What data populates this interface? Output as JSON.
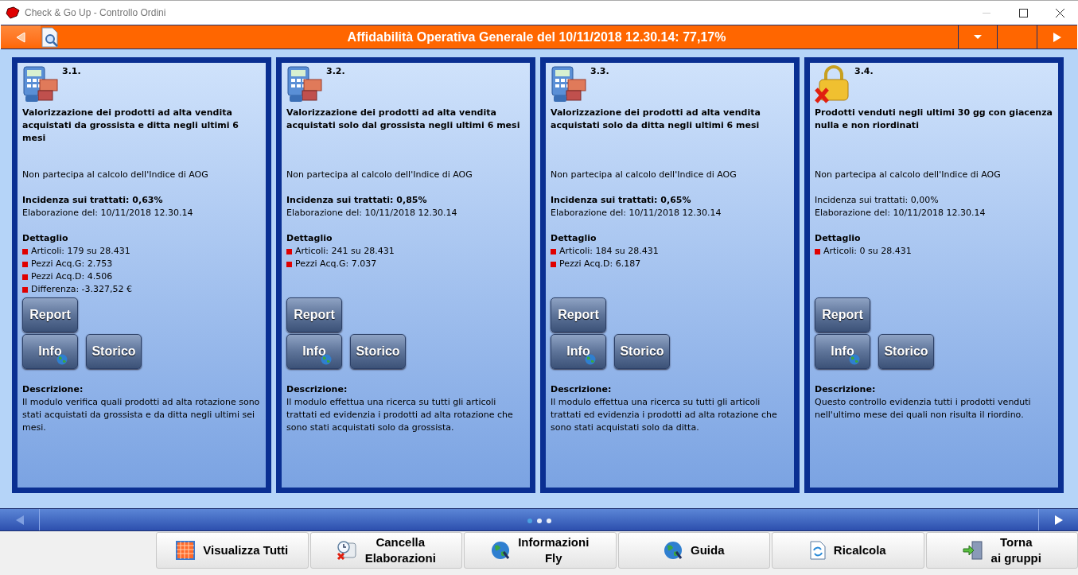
{
  "window": {
    "title": "Check & Go Up - Controllo Ordini"
  },
  "header": {
    "title": "Affidabilità Operativa Generale del 10/11/2018 12.30.14: 77,17%"
  },
  "cards": [
    {
      "kind": "calculator",
      "number": "3.1.",
      "title": "Valorizzazione dei prodotti ad alta vendita acquistati da grossista e ditta negli ultimi 6 mesi",
      "note": "Non partecipa al calcolo dell'Indice di AOG",
      "incidence": {
        "text": "Incidenza sui trattati: 0,63%",
        "emphasized": true
      },
      "elaboration": "Elaborazione del: 10/11/2018 12.30.14",
      "detail_heading": "Dettaglio",
      "details": [
        "Articoli: 179 su 28.431",
        "Pezzi Acq.G: 2.753",
        "Pezzi Acq.D: 4.506",
        "Differenza: -3.327,52 €"
      ],
      "buttons": {
        "report": "Report",
        "info": "Info",
        "history": "Storico"
      },
      "description_heading": "Descrizione:",
      "description": "Il modulo verifica quali prodotti ad alta rotazione sono stati acquistati da grossista e da ditta negli ultimi sei mesi."
    },
    {
      "kind": "calculator",
      "number": "3.2.",
      "title": "Valorizzazione dei prodotti ad alta vendita acquistati solo dal grossista negli ultimi 6 mesi",
      "note": "Non partecipa al calcolo dell'Indice di AOG",
      "incidence": {
        "text": "Incidenza sui trattati: 0,85%",
        "emphasized": true
      },
      "elaboration": "Elaborazione del: 10/11/2018 12.30.14",
      "detail_heading": "Dettaglio",
      "details": [
        "Articoli: 241 su 28.431",
        "Pezzi Acq.G: 7.037"
      ],
      "buttons": {
        "report": "Report",
        "info": "Info",
        "history": "Storico"
      },
      "description_heading": "Descrizione:",
      "description": "Il modulo effettua una ricerca su tutti gli articoli trattati ed evidenzia i prodotti ad alta rotazione che sono stati acquistati solo da grossista."
    },
    {
      "kind": "calculator",
      "number": "3.3.",
      "title": "Valorizzazione dei prodotti ad alta vendita acquistati solo da ditta negli ultimi 6 mesi",
      "note": "Non partecipa al calcolo dell'Indice di AOG",
      "incidence": {
        "text": "Incidenza sui trattati: 0,65%",
        "emphasized": true
      },
      "elaboration": "Elaborazione del: 10/11/2018 12.30.14",
      "detail_heading": "Dettaglio",
      "details": [
        "Articoli: 184 su 28.431",
        "Pezzi Acq.D: 6.187"
      ],
      "buttons": {
        "report": "Report",
        "info": "Info",
        "history": "Storico"
      },
      "description_heading": "Descrizione:",
      "description": "Il modulo effettua una ricerca su tutti gli articoli trattati ed evidenzia i prodotti ad alta rotazione che sono stati acquistati solo da ditta."
    },
    {
      "kind": "lock",
      "number": "3.4.",
      "title": "Prodotti venduti negli ultimi 30 gg con giacenza nulla e non riordinati",
      "note": "Non partecipa al calcolo dell'Indice di AOG",
      "incidence": {
        "text": "Incidenza sui trattati: 0,00%",
        "emphasized": false
      },
      "elaboration": "Elaborazione del: 10/11/2018 12.30.14",
      "detail_heading": "Dettaglio",
      "details": [
        "Articoli: 0 su 28.431"
      ],
      "buttons": {
        "report": "Report",
        "info": "Info",
        "history": "Storico"
      },
      "description_heading": "Descrizione:",
      "description": "Questo controllo evidenzia tutti i prodotti venduti nell'ultimo mese dei quali non risulta il riordino."
    }
  ],
  "pager": [
    {
      "selected": true
    },
    {
      "selected": false
    },
    {
      "selected": false
    }
  ],
  "bottom_buttons": [
    {
      "kind": "grid",
      "label": "Visualizza Tutti"
    },
    {
      "kind": "clock",
      "label": "Cancella\nElaborazioni"
    },
    {
      "kind": "globe",
      "label": "Informazioni\nFly"
    },
    {
      "kind": "globe",
      "label": "Guida"
    },
    {
      "kind": "refresh",
      "label": "Ricalcola"
    },
    {
      "kind": "door",
      "label": "Torna\nai gruppi"
    }
  ]
}
